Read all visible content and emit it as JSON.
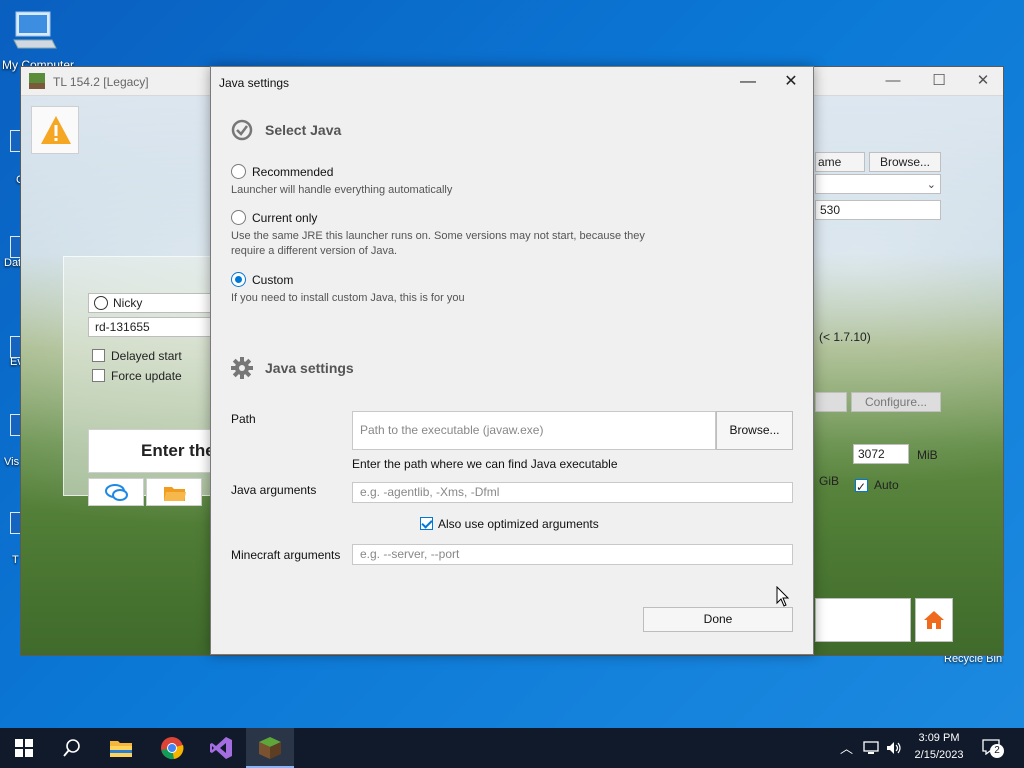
{
  "desktop": {
    "icons": [
      "My Computer",
      "Recycle Bin"
    ],
    "edge_labels": [
      "C",
      "Dat",
      "Ev",
      "Vis",
      "T"
    ]
  },
  "launcher": {
    "title": "TL 154.2 [Legacy]",
    "username": "Nicky",
    "version": "rd-131655",
    "delayed_start": "Delayed start",
    "force_update": "Force update",
    "enter_label": "Enter the",
    "right": {
      "name_btn": "ame",
      "browse_btn": "Browse...",
      "field_530": "530",
      "version_note": "(< 1.7.10)",
      "configure_btn": "Configure...",
      "memory_value": "3072",
      "memory_unit": "MiB",
      "gib_label": "GiB",
      "auto_label": "Auto"
    }
  },
  "dialog": {
    "title": "Java settings",
    "select_java_heading": "Select Java",
    "options": [
      {
        "label": "Recommended",
        "desc": "Launcher will handle everything automatically",
        "selected": false
      },
      {
        "label": "Current only",
        "desc": "Use the same JRE this launcher runs on. Some versions may not start, because they require a different version of Java.",
        "selected": false
      },
      {
        "label": "Custom",
        "desc": "If you need to install custom Java, this is for you",
        "selected": true
      }
    ],
    "java_settings_heading": "Java settings",
    "path_label": "Path",
    "path_placeholder": "Path to the executable (javaw.exe)",
    "browse_label": "Browse...",
    "path_hint": "Enter the path where we can find Java executable",
    "java_args_label": "Java arguments",
    "java_args_placeholder": "e.g. -agentlib, -Xms, -Dfml",
    "optimized_label": "Also use optimized arguments",
    "optimized_checked": true,
    "mc_args_label": "Minecraft arguments",
    "mc_args_placeholder": "e.g. --server, --port",
    "done_label": "Done"
  },
  "taskbar": {
    "time": "3:09 PM",
    "date": "2/15/2023",
    "notifications": "2"
  },
  "colors": {
    "accent": "#0078d7",
    "desktop": "#0b78d6",
    "taskbar": "#101a2a"
  }
}
